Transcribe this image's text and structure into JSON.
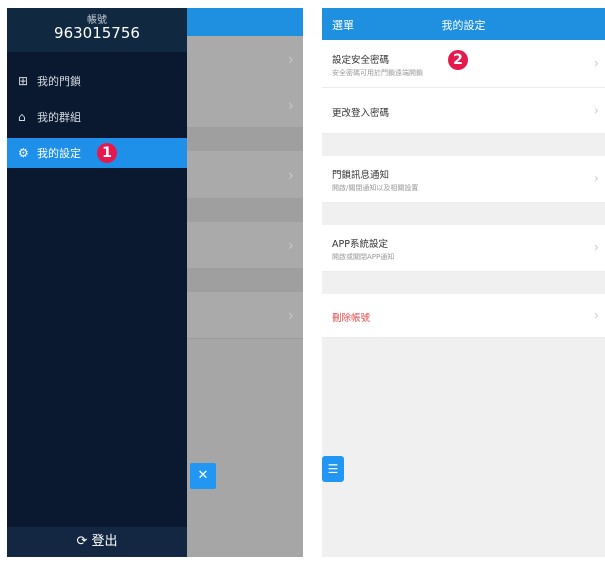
{
  "drawer": {
    "account_label": "帳號",
    "account_number": "963015756",
    "items": [
      {
        "icon": "grid-icon",
        "glyph": "⊞",
        "label": "我的門鎖"
      },
      {
        "icon": "home-icon",
        "glyph": "⌂",
        "label": "我的群組"
      },
      {
        "icon": "gear-icon",
        "glyph": "⚙",
        "label": "我的設定"
      }
    ],
    "logout_icon": "logout-icon",
    "logout_glyph": "⟳",
    "logout_label": "登出",
    "close_glyph": "✕"
  },
  "badges": [
    "1",
    "2"
  ],
  "settings": {
    "menu_label": "選單",
    "title": "我的設定",
    "rows": [
      {
        "title": "設定安全密碼",
        "subtitle": "安全密碼可用於門鎖遠端開鎖"
      },
      {
        "title": "更改登入密碼",
        "subtitle": ""
      },
      {
        "title": "門鎖訊息通知",
        "subtitle": "開啟/關閉通知以及相關設置"
      },
      {
        "title": "APP系統設定",
        "subtitle": "開啟或關閉APP通知"
      },
      {
        "title": "刪除帳號",
        "subtitle": ""
      }
    ],
    "chevron": "›",
    "fab_glyph": "☰"
  },
  "colors": {
    "accent": "#1f8fe0",
    "drawer_bg": "#0a1930",
    "badge": "#e5194e",
    "danger": "#e24a4a"
  }
}
